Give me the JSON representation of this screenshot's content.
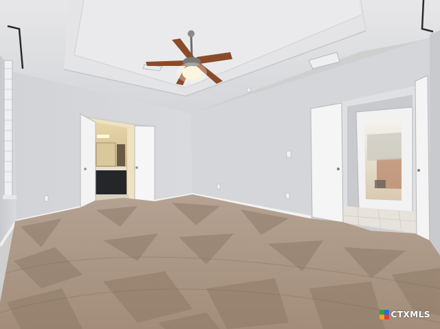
{
  "scene": {
    "watermark": {
      "text": "CTXMLS",
      "colors": [
        "#2ea043",
        "#1f6feb",
        "#f0a020",
        "#d93f3f"
      ]
    },
    "palette": {
      "wall": "#d7d8da",
      "ceiling": "#dcdcde",
      "carpet": "#a99482",
      "door": "#f4f4f4",
      "fan_wood": "#8a4b2a"
    }
  }
}
